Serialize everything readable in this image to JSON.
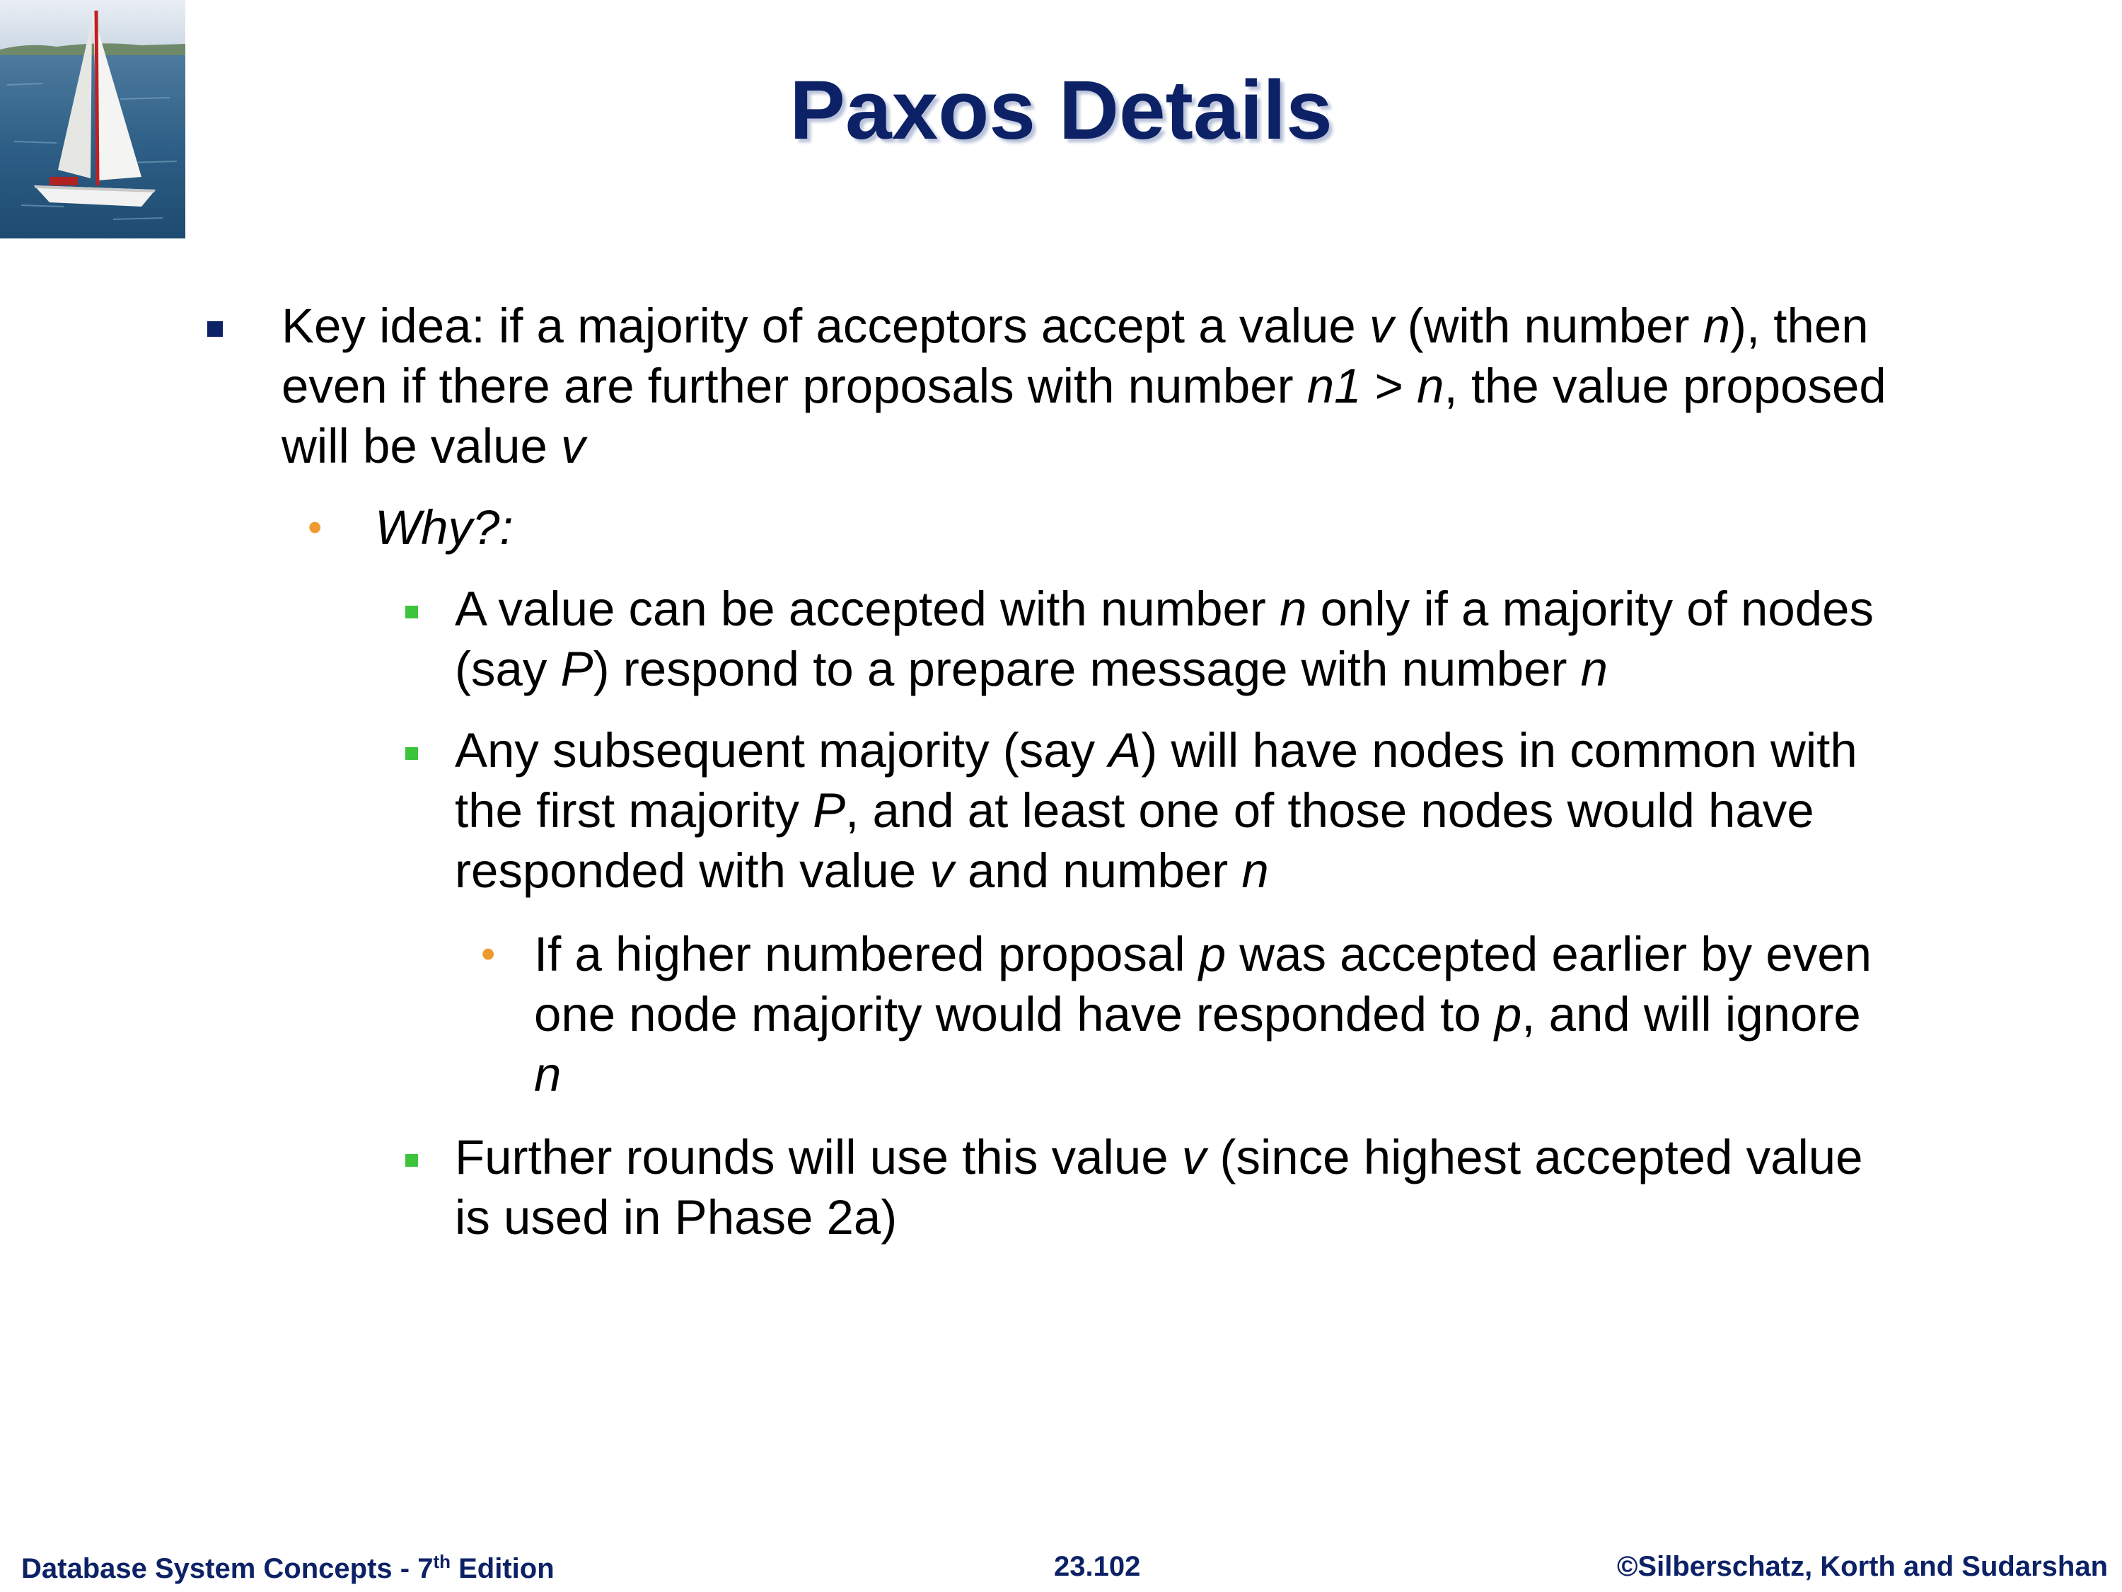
{
  "slide": {
    "title": "Paxos Details",
    "logo_icon": "sailboat-photo"
  },
  "bullets": {
    "b1": {
      "l1a": "Key idea: if a majority of acceptors accept a value ",
      "l1b": "v",
      "l1c": " (with number ",
      "l1d": "n",
      "l1e": "), then",
      "l2a": "even if there are further proposals with number ",
      "l2b": "n1",
      "l2c": " > ",
      "l2d": "n",
      "l2e": ", the value proposed",
      "l3a": "will be value ",
      "l3b": "v"
    },
    "b2": {
      "text": "Why?:"
    },
    "b3": {
      "l1a": "A value can be accepted with number ",
      "l1b": "n",
      "l1c": " only if a majority of nodes",
      "l2a": "(say ",
      "l2b": "P",
      "l2c": ") respond to a prepare message with number ",
      "l2d": "n"
    },
    "b4": {
      "l1a": "Any subsequent majority (say ",
      "l1b": "A",
      "l1c": ") will have nodes in common with",
      "l2a": "the first majority ",
      "l2b": "P",
      "l2c": ", and at least one of those nodes would have",
      "l3a": "responded with value ",
      "l3b": "v",
      "l3c": " and number ",
      "l3d": "n"
    },
    "b5": {
      "l1a": "If a higher numbered proposal ",
      "l1b": "p",
      "l1c": " was accepted earlier by even",
      "l2a": "one node majority would have responded to ",
      "l2b": "p",
      "l2c": ", and will ignore",
      "l3a": "n"
    },
    "b6": {
      "l1a": "Further rounds will use this value ",
      "l1b": "v",
      "l1c": " (since highest accepted value",
      "l2a": "is used in Phase 2a)"
    }
  },
  "footer": {
    "left_a": "Database System Concepts - 7",
    "left_sup": "th",
    "left_b": " Edition",
    "center": "23.102",
    "right": "©Silberschatz, Korth and Sudarshan"
  },
  "colors": {
    "title": "#0d2266",
    "bullet_l1": "#0d2266",
    "bullet_l2": "#ef9a2e",
    "bullet_l3": "#3cc43c",
    "footer": "#0d2266"
  }
}
